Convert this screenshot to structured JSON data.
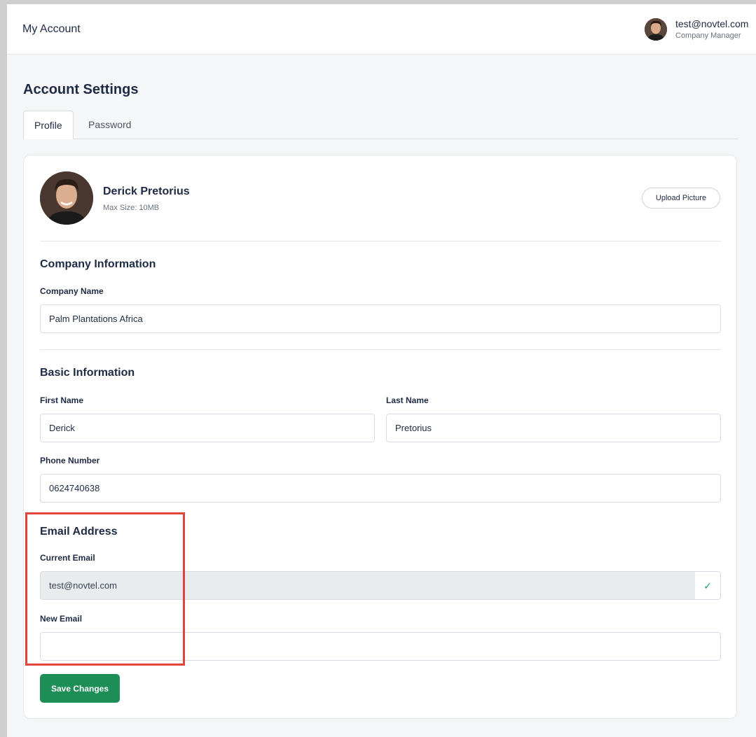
{
  "header": {
    "title": "My Account",
    "user_email": "test@novtel.com",
    "user_role": "Company Manager",
    "avatar_icon": "user-avatar-photo"
  },
  "page": {
    "title": "Account Settings"
  },
  "tabs": [
    {
      "label": "Profile",
      "active": true
    },
    {
      "label": "Password",
      "active": false
    }
  ],
  "profile": {
    "name": "Derick Pretorius",
    "max_size": "Max Size: 10MB",
    "upload_label": "Upload Picture"
  },
  "company": {
    "section_title": "Company Information",
    "company_name_label": "Company Name",
    "company_name_value": "Palm Plantations Africa"
  },
  "basic": {
    "section_title": "Basic Information",
    "first_name_label": "First Name",
    "first_name_value": "Derick",
    "last_name_label": "Last Name",
    "last_name_value": "Pretorius",
    "phone_label": "Phone Number",
    "phone_value": "0624740638"
  },
  "email": {
    "section_title": "Email Address",
    "current_label": "Current Email",
    "current_value": "test@novtel.com",
    "verified_icon": "check-icon",
    "new_label": "New Email",
    "new_value": ""
  },
  "actions": {
    "save_label": "Save Changes"
  },
  "colors": {
    "accent": "#1e8e57",
    "highlight": "#e0443a",
    "verified": "#22a35a"
  }
}
